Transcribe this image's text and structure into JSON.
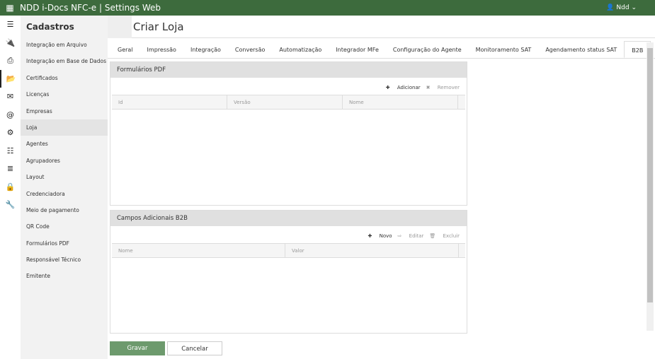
{
  "app": {
    "title": "NDD i-Docs NFC-e | Settings Web",
    "user": "Ndd"
  },
  "rail": [
    "menu-icon",
    "plug-icon",
    "print-icon",
    "folder-icon",
    "mail-icon",
    "at-icon",
    "gear-icon",
    "sliders-icon",
    "server-icon",
    "lock-icon",
    "wrench-icon"
  ],
  "sidebar": {
    "title": "Cadastros",
    "items": [
      "Integração em Arquivo",
      "Integração em Base de Dados",
      "Certificados",
      "Licenças",
      "Empresas",
      "Loja",
      "Agentes",
      "Agrupadores",
      "Layout",
      "Credenciadora",
      "Meio de pagamento",
      "QR Code",
      "Formulários PDF",
      "Responsável Técnico",
      "Emitente"
    ],
    "selected": "Loja"
  },
  "page": {
    "title": "Criar Loja"
  },
  "tabs": [
    "Geral",
    "Impressão",
    "Integração",
    "Conversão",
    "Automatização",
    "Integrador MFe",
    "Configuração do Agente",
    "Monitoramento SAT",
    "Agendamento status SAT",
    "B2B"
  ],
  "pdf": {
    "title": "Formulários PDF",
    "add": "Adicionar",
    "remove": "Remover",
    "columns": [
      "Id",
      "Versão",
      "Nome"
    ]
  },
  "b2b": {
    "title": "Campos Adicionais B2B",
    "new": "Novo",
    "edit": "Editar",
    "delete": "Excluir",
    "columns": [
      "Nome",
      "Valor"
    ]
  },
  "footer": {
    "save": "Gravar",
    "cancel": "Cancelar"
  }
}
